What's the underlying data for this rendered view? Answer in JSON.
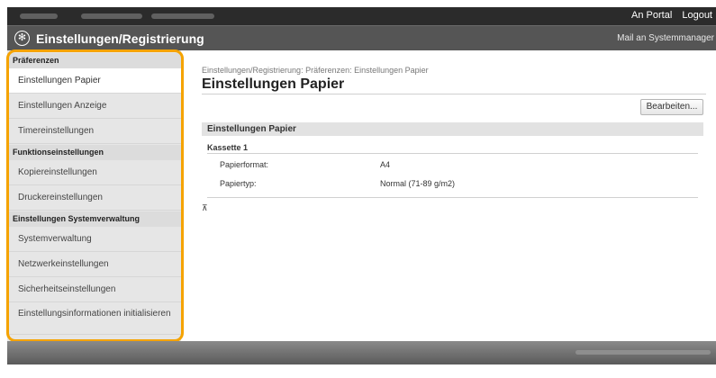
{
  "header": {
    "links": {
      "portal": "An Portal",
      "logout": "Logout"
    },
    "app_title": "Einstellungen/Registrierung",
    "mail_link": "Mail an Systemmanager"
  },
  "sidebar": {
    "groups": [
      {
        "heading": "Präferenzen",
        "items": [
          "Einstellungen Papier",
          "Einstellungen Anzeige",
          "Timereinstellungen"
        ]
      },
      {
        "heading": "Funktionseinstellungen",
        "items": [
          "Kopiereinstellungen",
          "Druckereinstellungen"
        ]
      },
      {
        "heading": "Einstellungen Systemverwaltung",
        "items": [
          "Systemverwaltung",
          "Netzwerkeinstellungen",
          "Sicherheitseinstellungen",
          "Einstellungsinformationen initialisieren"
        ]
      }
    ],
    "active_item": "Einstellungen Papier"
  },
  "main": {
    "breadcrumb": "Einstellungen/Registrierung: Präferenzen: Einstellungen Papier",
    "title": "Einstellungen Papier",
    "edit_button": "Bearbeiten...",
    "section_title": "Einstellungen Papier",
    "subsection": "Kassette 1",
    "rows": [
      {
        "label": "Papierformat:",
        "value": "A4"
      },
      {
        "label": "Papiertyp:",
        "value": "Normal (71-89 g/m2)"
      }
    ],
    "top_link": "⊼"
  },
  "colors": {
    "highlight": "#f5a300",
    "titlebar": "#555555",
    "topbar": "#2b2b2b"
  }
}
